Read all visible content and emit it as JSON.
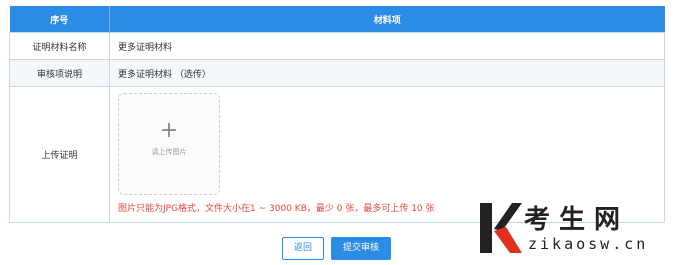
{
  "table": {
    "headers": [
      "序号",
      "材料项"
    ],
    "rows": [
      {
        "label": "证明材料名称",
        "value": "更多证明材料"
      },
      {
        "label": "审核项说明",
        "value": "更多证明材料 （选传）"
      },
      {
        "label": "上传证明"
      }
    ]
  },
  "upload": {
    "placeholder": "请上传图片",
    "hint": "图片只能为JPG格式，文件大小在1 ~ 3000 KB，最少 0 张，最多可上传 10 张"
  },
  "actions": {
    "back_label": "返回",
    "submit_label": "提交审核"
  },
  "watermark": {
    "brand_cn": "考生网",
    "domain": "zikaosw.cn"
  },
  "colors": {
    "accent": "#2b8ce6",
    "hint": "#e8473c",
    "brand_red": "#e0311f"
  }
}
